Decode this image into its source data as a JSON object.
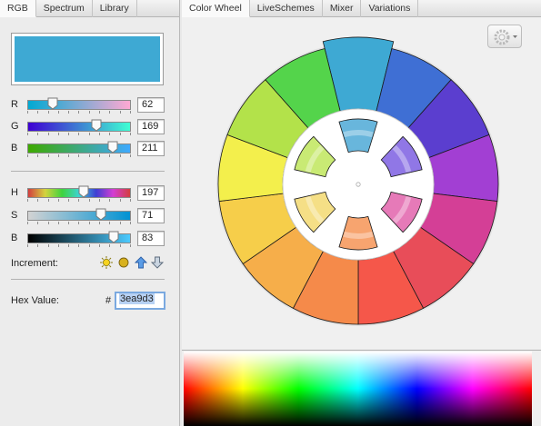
{
  "left_tabs": [
    "RGB",
    "Spectrum",
    "Library"
  ],
  "right_tabs": [
    "Color Wheel",
    "LiveSchemes",
    "Mixer",
    "Variations"
  ],
  "current_color": "#3ea9d3",
  "sliders_rgb": [
    {
      "label": "R",
      "value": "62",
      "level": 0.243
    },
    {
      "label": "G",
      "value": "169",
      "level": 0.663
    },
    {
      "label": "B",
      "value": "211",
      "level": 0.827
    }
  ],
  "sliders_hsb": [
    {
      "label": "H",
      "value": "197",
      "level": 0.547
    },
    {
      "label": "S",
      "value": "71",
      "level": 0.71
    },
    {
      "label": "B",
      "value": "83",
      "level": 0.83
    }
  ],
  "increment": {
    "label": "Increment:",
    "icons": [
      "sun-icon",
      "moon-icon",
      "arrow-up-icon",
      "arrow-down-icon"
    ]
  },
  "hex": {
    "label": "Hex Value:",
    "hash": "#",
    "value": "3ea9d3"
  },
  "wheel": {
    "outer_colors": [
      "#3ea9d3",
      "#3f6fd4",
      "#5b3ecf",
      "#a23fd3",
      "#d43f96",
      "#e84d59",
      "#f5574a",
      "#f58a4a",
      "#f6ae4a",
      "#f6ce4a",
      "#f3ef4c",
      "#b3e24a",
      "#54d44b"
    ],
    "inner_colors": [
      "#68b6dc",
      "#9077e6",
      "#e67ab8",
      "#f7a46f",
      "#f5df86",
      "#c9ea74"
    ]
  }
}
